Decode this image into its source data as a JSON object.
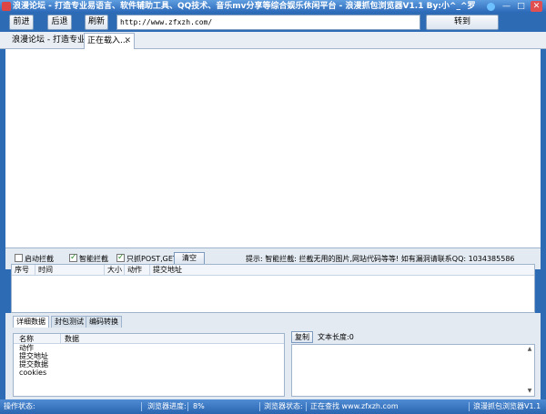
{
  "window": {
    "title": "浪漫论坛 - 打造专业易语言、软件辅助工具、QQ技术、音乐mv分享等综合娱乐休闲平台 - 浪漫抓包浏览器V1.1 By:小^_^罗"
  },
  "toolbar": {
    "back_label": "前进",
    "forward_label": "后退",
    "refresh_label": "刷新",
    "url_value": "http://www.zfxzh.com/",
    "go_label": "转到"
  },
  "tabs": [
    {
      "label": "浪漫论坛 - 打造专业"
    },
    {
      "label": "正在载入..."
    }
  ],
  "options": {
    "auto_intercept": {
      "label": "启动拦截",
      "checked": false
    },
    "smart_intercept": {
      "label": "智能拦截",
      "checked": true
    },
    "only_post_get": {
      "label": "只抓POST,GET",
      "checked": true
    },
    "clear_label": "清空",
    "tip": "提示: 智能拦截: 拦截无用的图片,网站代码等等!  如有漏洞请联系QQ: 1034385586"
  },
  "packet_table": {
    "columns": [
      "序号",
      "时间",
      "大小",
      "动作",
      "提交地址"
    ],
    "rows": []
  },
  "lower_tabs": [
    {
      "label": "详细数据"
    },
    {
      "label": "封包测试"
    },
    {
      "label": "编码转换"
    }
  ],
  "detail": {
    "columns": [
      "名称",
      "数据"
    ],
    "rows": [
      "动作",
      "提交地址",
      "提交数据",
      "cookies"
    ]
  },
  "copy_label": "复制",
  "text_length_label": "文本长度:0",
  "status": {
    "op_label": "操作状态:",
    "progress_label": "浏览器进度:",
    "progress_value": "8%",
    "browser_label": "浏览器状态:",
    "browser_value": "正在查找 www.zfxzh.com",
    "app_name": "浪漫抓包浏览器V1.1"
  },
  "colors": {
    "frame": "#2d6bb5",
    "panel": "#e3eaf2",
    "check": "#2a8a2a"
  }
}
